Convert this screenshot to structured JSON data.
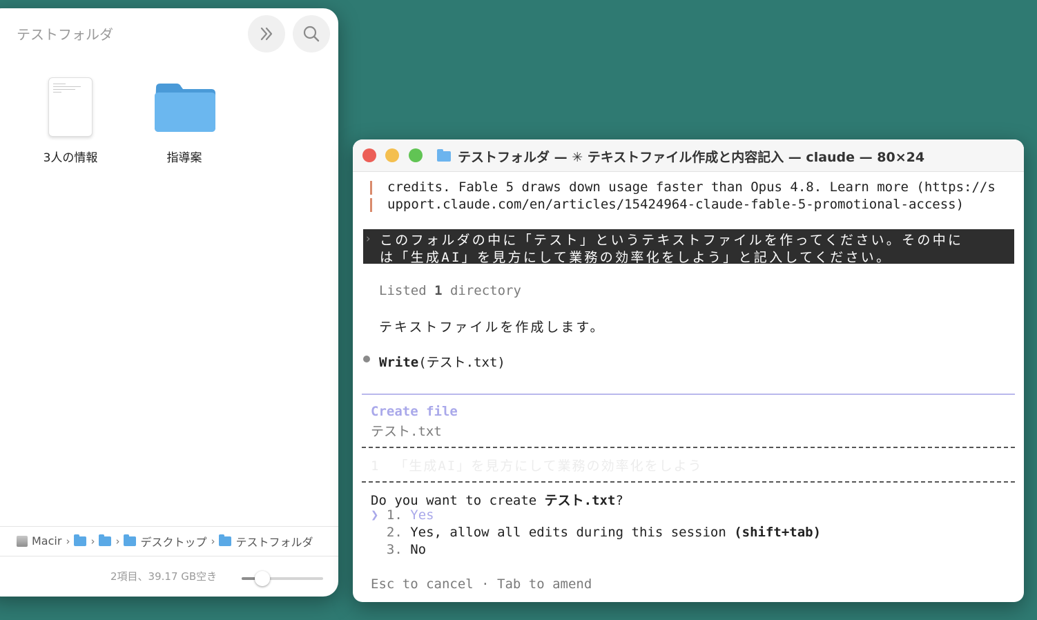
{
  "finder": {
    "title": "テストフォルダ",
    "items": [
      {
        "label": "3人の情報",
        "icon": "text-document-icon"
      },
      {
        "label": "指導案",
        "icon": "folder-icon"
      }
    ],
    "path": [
      "Macir",
      "デスクトップ",
      "テストフォルダ"
    ],
    "status": "2項目、39.17 GB空き",
    "icon_size_level": 0.25
  },
  "terminal": {
    "title": "テストフォルダ — ✳ テキストファイル作成と内容記入 — claude — 80×24",
    "notice_lines": [
      "credits. Fable 5 draws down usage faster than Opus 4.8. Learn more (https://s",
      "upport.claude.com/en/articles/15424964-claude-fable-5-promotional-access)"
    ],
    "prompt_caret": "›",
    "prompt_lines": [
      "このフォルダの中に「テスト」というテキストファイルを作ってください。その中に",
      "は「生成AI」を見方にして業務の効率化をしよう」と記入してください。"
    ],
    "listed": {
      "prefix": "Listed ",
      "count": "1",
      "suffix": " directory"
    },
    "reply": "テキストファイルを作成します。",
    "tool_call": {
      "name": "Write",
      "args": "(テスト.txt)"
    },
    "create_heading": "Create file",
    "create_filename": "テスト.txt",
    "preview": {
      "line_no": "1",
      "text": "「生成AI」を見方にして業務の効率化をしよう"
    },
    "question": {
      "prefix": "Do you want to create ",
      "filename": "テスト.txt",
      "suffix": "?"
    },
    "selector": "❯",
    "options": [
      {
        "num": "1.",
        "label": "Yes",
        "hint": ""
      },
      {
        "num": "2.",
        "label": "Yes, allow all edits during this session ",
        "hint": "(shift+tab)"
      },
      {
        "num": "3.",
        "label": "No",
        "hint": ""
      }
    ],
    "footer": "Esc to cancel · Tab to amend"
  },
  "colors": {
    "desktop": "#2f7a72",
    "accent_lavender": "#a9a8ea",
    "close": "#ec5f57",
    "minimize": "#f4bf4f",
    "zoom": "#61c454"
  }
}
